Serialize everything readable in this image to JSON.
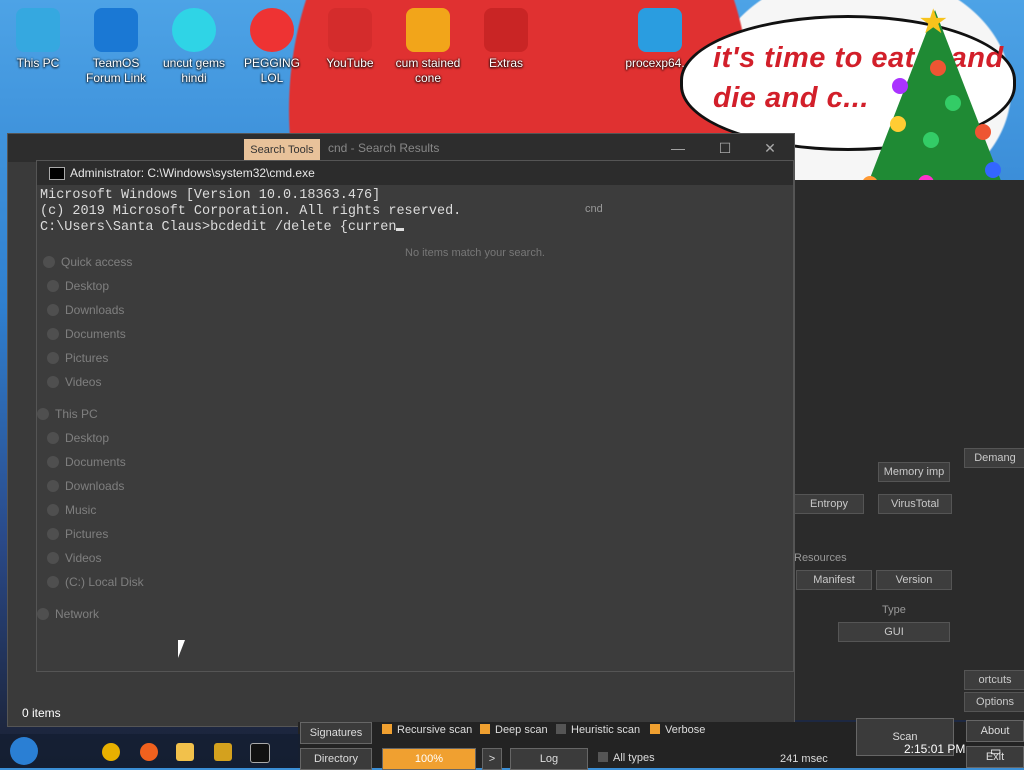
{
  "desktop": {
    "icons": [
      {
        "label": "This PC"
      },
      {
        "label": "TeamOS Forum Link"
      },
      {
        "label": "uncut gems hindi"
      },
      {
        "label": "PEGGING LOL"
      },
      {
        "label": "YouTube"
      },
      {
        "label": "cum stained cone"
      },
      {
        "label": "Extras"
      },
      {
        "label": "procexp64...."
      }
    ],
    "speech_text": "it's time to eat it and die and c..."
  },
  "explorer": {
    "search_tools_tab": "Search Tools",
    "caption": "cnd - Search Results",
    "search_query": "cnd",
    "no_items": "No items match your search.",
    "status": "0 items",
    "nav": [
      "Quick access",
      "Desktop",
      "Downloads",
      "Documents",
      "Pictures",
      "Videos",
      "This PC",
      "Desktop",
      "Documents",
      "Downloads",
      "Music",
      "Pictures",
      "Videos",
      "(C:) Local Disk",
      "Network"
    ]
  },
  "cmd": {
    "title": "Administrator: C:\\Windows\\system32\\cmd.exe",
    "line1": "Microsoft Windows [Version 10.0.18363.476]",
    "line2": "(c) 2019 Microsoft Corporation. All rights reserved.",
    "line3": "",
    "prompt": "C:\\Users\\Santa Claus>bcdedit /delete {curren"
  },
  "right_app": {
    "buttons": [
      "Memory imp",
      "Entropy",
      "VirusTotal",
      "Manifest",
      "Version",
      "GUI",
      "Demang"
    ],
    "labels": [
      "Resources",
      "Type"
    ]
  },
  "bottom": {
    "signatures": "Signatures",
    "recursive_scan": "Recursive scan",
    "deep_scan": "Deep scan",
    "heuristic_scan": "Heuristic scan",
    "verbose": "Verbose",
    "directory": "Directory",
    "progress": "100%",
    "arrow": ">",
    "log": "Log",
    "all_types": "All types",
    "time_msec": "241 msec",
    "scan": "Scan",
    "about": "About",
    "exit": "Exit",
    "options": "Options",
    "shortcuts": "ortcuts"
  },
  "tray": {
    "clock": "2:15:01 PM"
  },
  "colors": {
    "accent": "#f0a030",
    "cmd_bg": "#3c3c3c",
    "titlebar": "#2c2c2c"
  }
}
